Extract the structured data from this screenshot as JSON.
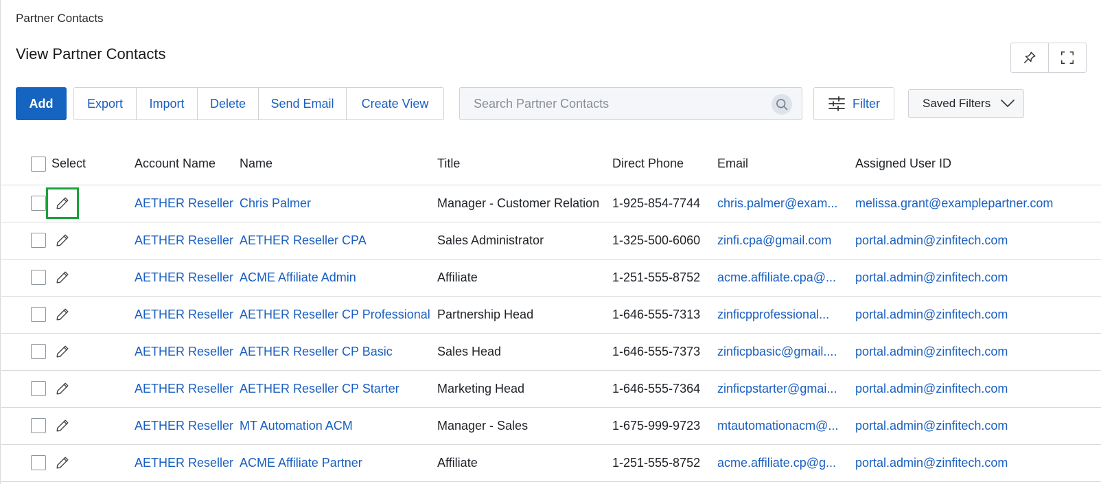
{
  "breadcrumb": "Partner Contacts",
  "page_title": "View Partner Contacts",
  "corner_tools": {
    "pin_icon": "pin-icon",
    "fullscreen_icon": "fullscreen-icon"
  },
  "toolbar": {
    "add": "Add",
    "export": "Export",
    "import": "Import",
    "delete": "Delete",
    "send_email": "Send Email",
    "create_view": "Create View"
  },
  "search": {
    "placeholder": "Search Partner Contacts",
    "value": ""
  },
  "filter": {
    "label": "Filter"
  },
  "saved_filters": {
    "label": "Saved Filters"
  },
  "table": {
    "columns": {
      "select": "Select",
      "account_name": "Account Name",
      "name": "Name",
      "title": "Title",
      "direct_phone": "Direct Phone",
      "email": "Email",
      "assigned_user": "Assigned User ID"
    },
    "rows": [
      {
        "account": "AETHER Reseller",
        "name": "Chris Palmer",
        "title": "Manager - Customer Relation",
        "phone": "1-925-854-7744",
        "email": "chris.palmer@exam...",
        "assigned": "melissa.grant@examplepartner.com"
      },
      {
        "account": "AETHER Reseller",
        "name": "AETHER Reseller CPA",
        "title": "Sales Administrator",
        "phone": "1-325-500-6060",
        "email": "zinfi.cpa@gmail.com",
        "assigned": "portal.admin@zinfitech.com"
      },
      {
        "account": "AETHER Reseller",
        "name": "ACME Affiliate Admin",
        "title": "Affiliate",
        "phone": "1-251-555-8752",
        "email": "acme.affiliate.cpa@...",
        "assigned": "portal.admin@zinfitech.com"
      },
      {
        "account": "AETHER Reseller",
        "name": "AETHER Reseller CP Professional",
        "title": "Partnership Head",
        "phone": "1-646-555-7313",
        "email": "zinficpprofessional...",
        "assigned": "portal.admin@zinfitech.com"
      },
      {
        "account": "AETHER Reseller",
        "name": "AETHER Reseller CP Basic",
        "title": "Sales Head",
        "phone": "1-646-555-7373",
        "email": "zinficpbasic@gmail....",
        "assigned": "portal.admin@zinfitech.com"
      },
      {
        "account": "AETHER Reseller",
        "name": "AETHER Reseller CP Starter",
        "title": "Marketing Head",
        "phone": "1-646-555-7364",
        "email": "zinficpstarter@gmai...",
        "assigned": "portal.admin@zinfitech.com"
      },
      {
        "account": "AETHER Reseller",
        "name": "MT Automation ACM",
        "title": "Manager - Sales",
        "phone": "1-675-999-9723",
        "email": "mtautomationacm@...",
        "assigned": "portal.admin@zinfitech.com"
      },
      {
        "account": "AETHER Reseller",
        "name": "ACME Affiliate Partner",
        "title": "Affiliate",
        "phone": "1-251-555-8752",
        "email": "acme.affiliate.cp@g...",
        "assigned": "portal.admin@zinfitech.com"
      }
    ]
  },
  "colors": {
    "primary": "#1565c0",
    "link": "#1a5fc0",
    "focus_outline": "#1aa33a",
    "border": "#cfd3d8"
  }
}
